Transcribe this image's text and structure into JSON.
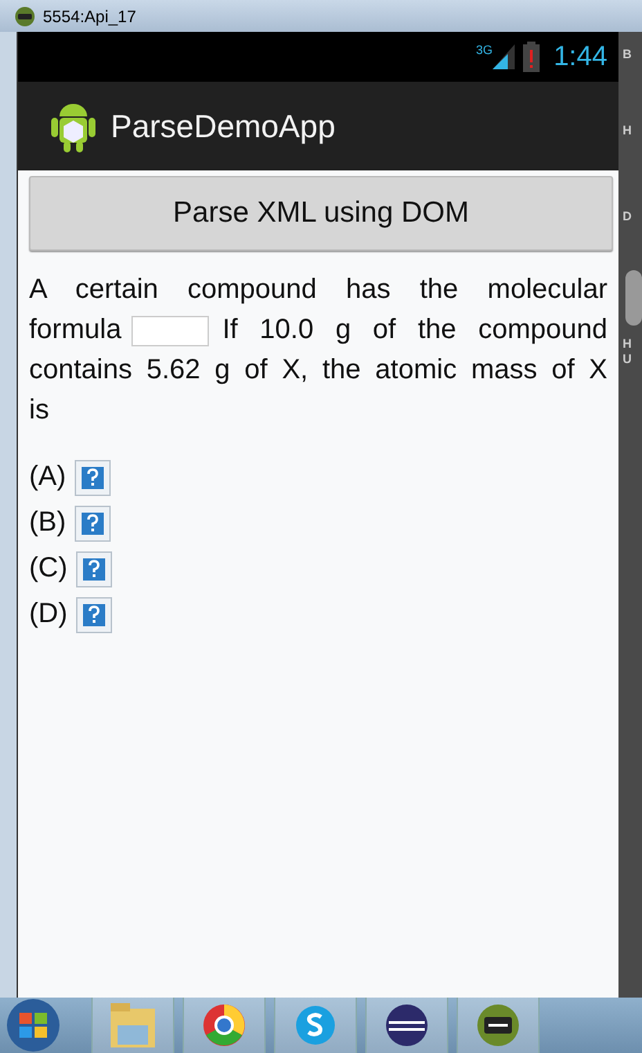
{
  "window": {
    "title": "5554:Api_17"
  },
  "status_bar": {
    "network": "3G",
    "time": "1:44"
  },
  "action_bar": {
    "title": "ParseDemoApp"
  },
  "button": {
    "label": "Parse XML using DOM"
  },
  "question": {
    "lines": [
      {
        "kind": "text",
        "text": "A certain compound has the molecular"
      },
      {
        "kind": "blank",
        "before": "formula",
        "after": "If 10.0 g of the compound"
      },
      {
        "kind": "text",
        "text": "contains 5.62 g of X, the atomic mass of X"
      },
      {
        "kind": "text",
        "text": "is"
      }
    ]
  },
  "options": [
    {
      "label": "(A)"
    },
    {
      "label": "(B)"
    },
    {
      "label": "(C)"
    },
    {
      "label": "(D)"
    }
  ],
  "side_panel": {
    "labels": [
      "B",
      "H",
      "D",
      "H",
      "U"
    ]
  },
  "taskbar": {
    "items": [
      {
        "kind": "start"
      },
      {
        "kind": "folder"
      },
      {
        "kind": "chrome"
      },
      {
        "kind": "skype"
      },
      {
        "kind": "eclipse"
      },
      {
        "kind": "android"
      }
    ]
  }
}
